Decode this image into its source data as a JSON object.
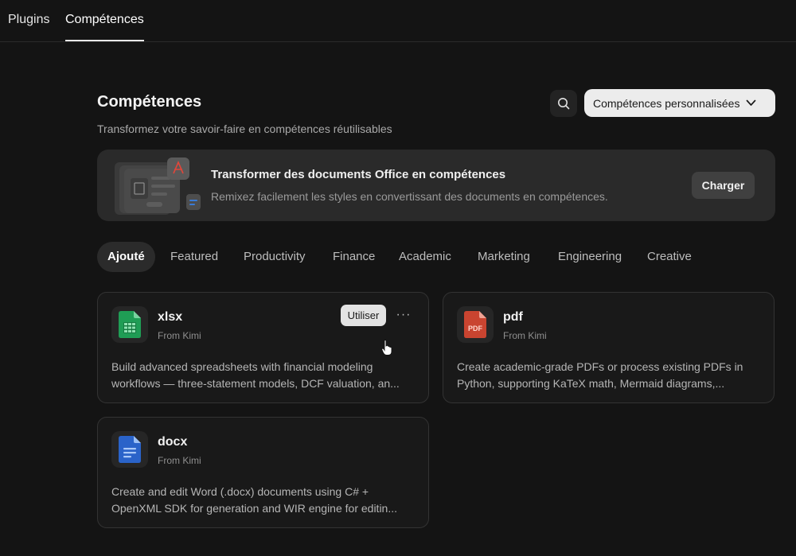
{
  "topnav": {
    "tabs": [
      {
        "label": "Plugins",
        "active": false
      },
      {
        "label": "Compétences",
        "active": true
      }
    ]
  },
  "header": {
    "title": "Compétences",
    "subtitle": "Transformez votre savoir-faire en compétences réutilisables",
    "search_icon": "search-icon",
    "dropdown_label": "Compétences personnalisées"
  },
  "banner": {
    "title": "Transformer des documents Office en compétences",
    "description": "Remixez facilement les styles en convertissant des documents en compétences.",
    "upload_label": "Charger"
  },
  "categories": [
    {
      "label": "Ajouté",
      "active": true
    },
    {
      "label": "Featured",
      "active": false
    },
    {
      "label": "Productivity",
      "active": false
    },
    {
      "label": "Finance",
      "active": false
    },
    {
      "label": "Academic",
      "active": false
    },
    {
      "label": "Marketing",
      "active": false
    },
    {
      "label": "Engineering",
      "active": false
    },
    {
      "label": "Creative",
      "active": false
    }
  ],
  "skills": [
    {
      "name": "xlsx",
      "from": "From Kimi",
      "icon": "spreadsheet-icon",
      "color": "#22a45d",
      "desc_line1": "Build advanced spreadsheets with financial modeling",
      "desc_line2": "workflows — three-statement models, DCF valuation, an...",
      "use_label": "Utiliser",
      "more_label": "···"
    },
    {
      "name": "pdf",
      "from": "From Kimi",
      "icon": "pdf-icon",
      "color": "#e0503a",
      "icon_text": "PDF",
      "desc_line1": "Create academic-grade PDFs or process existing PDFs in",
      "desc_line2": "Python, supporting KaTeX math, Mermaid diagrams,..."
    },
    {
      "name": "docx",
      "from": "From Kimi",
      "icon": "word-document-icon",
      "color": "#2f6fe0",
      "desc_line1": "Create and edit Word (.docx) documents using C# +",
      "desc_line2": "OpenXML SDK for generation and WIR engine for editin..."
    }
  ],
  "colors": {
    "background": "#141414",
    "card": "#191919",
    "banner": "#2a2a2a"
  }
}
